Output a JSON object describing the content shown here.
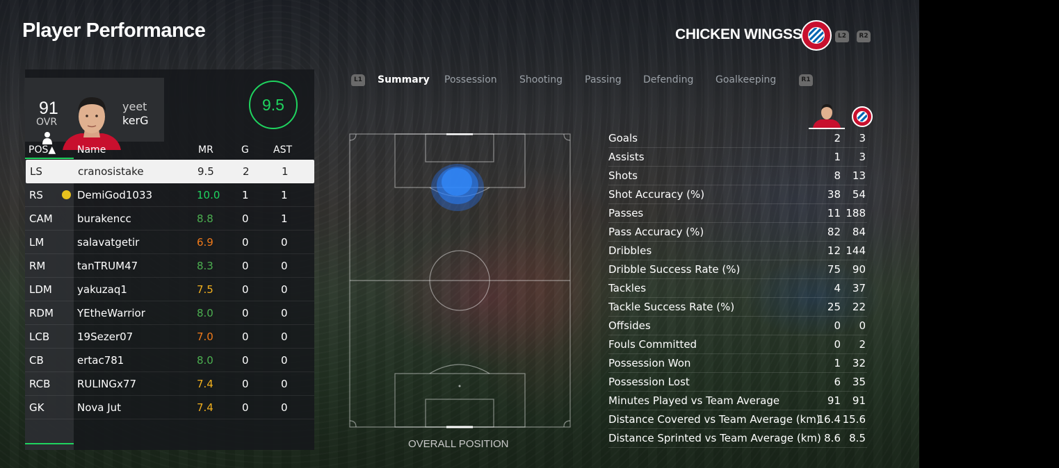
{
  "page": {
    "title": "Player Performance"
  },
  "club": {
    "name": "CHICKEN WINGSS",
    "hint_left": "L2",
    "hint_right": "R2",
    "colors": {
      "red": "#c8102e",
      "blue": "#0066b2"
    }
  },
  "player": {
    "ovr": "91",
    "ovr_label": "OVR",
    "first_name": "yeet",
    "last_name": "kerG",
    "match_rating": "9.5"
  },
  "table": {
    "headers": {
      "pos": "POS▲",
      "name": "Name",
      "mr": "MR",
      "g": "G",
      "ast": "AST"
    },
    "rows": [
      {
        "pos": "LS",
        "name": "cranosistake",
        "mr": "9.5",
        "g": "2",
        "ast": "1",
        "color": "#222222"
      },
      {
        "pos": "RS",
        "name": "DemiGod1033",
        "mr": "10.0",
        "g": "1",
        "ast": "1",
        "color": "#1fd45f"
      },
      {
        "pos": "CAM",
        "name": "burakencc",
        "mr": "8.8",
        "g": "0",
        "ast": "1",
        "color": "#4caf50"
      },
      {
        "pos": "LM",
        "name": "salavatgetir",
        "mr": "6.9",
        "g": "0",
        "ast": "0",
        "color": "#f07a1a"
      },
      {
        "pos": "RM",
        "name": "tanTRUM47",
        "mr": "8.3",
        "g": "0",
        "ast": "0",
        "color": "#4caf50"
      },
      {
        "pos": "LDM",
        "name": "yakuzaq1",
        "mr": "7.5",
        "g": "0",
        "ast": "0",
        "color": "#f2b01e"
      },
      {
        "pos": "RDM",
        "name": "YEtheWarrior",
        "mr": "8.0",
        "g": "0",
        "ast": "0",
        "color": "#4caf50"
      },
      {
        "pos": "LCB",
        "name": "19Sezer07",
        "mr": "7.0",
        "g": "0",
        "ast": "0",
        "color": "#f07a1a"
      },
      {
        "pos": "CB",
        "name": "ertac781",
        "mr": "8.0",
        "g": "0",
        "ast": "0",
        "color": "#4caf50"
      },
      {
        "pos": "RCB",
        "name": "RULINGx77",
        "mr": "7.4",
        "g": "0",
        "ast": "0",
        "color": "#f2b01e"
      },
      {
        "pos": "GK",
        "name": "Nova Jut",
        "mr": "7.4",
        "g": "0",
        "ast": "0",
        "color": "#f2b01e"
      }
    ]
  },
  "tabs": {
    "hint_left": "L1",
    "hint_right": "R1",
    "items": [
      "Summary",
      "Possession",
      "Shooting",
      "Passing",
      "Defending",
      "Goalkeeping"
    ],
    "active": "Summary"
  },
  "pitch": {
    "label": "OVERALL POSITION"
  },
  "stats": [
    {
      "label": "Goals",
      "player": "2",
      "team": "3"
    },
    {
      "label": "Assists",
      "player": "1",
      "team": "3"
    },
    {
      "label": "Shots",
      "player": "8",
      "team": "13"
    },
    {
      "label": "Shot Accuracy (%)",
      "player": "38",
      "team": "54"
    },
    {
      "label": "Passes",
      "player": "11",
      "team": "188"
    },
    {
      "label": "Pass Accuracy (%)",
      "player": "82",
      "team": "84"
    },
    {
      "label": "Dribbles",
      "player": "12",
      "team": "144"
    },
    {
      "label": "Dribble Success Rate (%)",
      "player": "75",
      "team": "90"
    },
    {
      "label": "Tackles",
      "player": "4",
      "team": "37"
    },
    {
      "label": "Tackle Success Rate (%)",
      "player": "25",
      "team": "22"
    },
    {
      "label": "Offsides",
      "player": "0",
      "team": "0"
    },
    {
      "label": "Fouls Committed",
      "player": "0",
      "team": "2"
    },
    {
      "label": "Possession Won",
      "player": "1",
      "team": "32"
    },
    {
      "label": "Possession Lost",
      "player": "6",
      "team": "35"
    },
    {
      "label": "Minutes Played vs Team Average",
      "player": "91",
      "team": "91"
    },
    {
      "label": "Distance Covered vs Team Average (km)",
      "player": "16.4",
      "team": "15.6"
    },
    {
      "label": "Distance Sprinted vs Team Average (km)",
      "player": "8.6",
      "team": "8.5"
    }
  ]
}
